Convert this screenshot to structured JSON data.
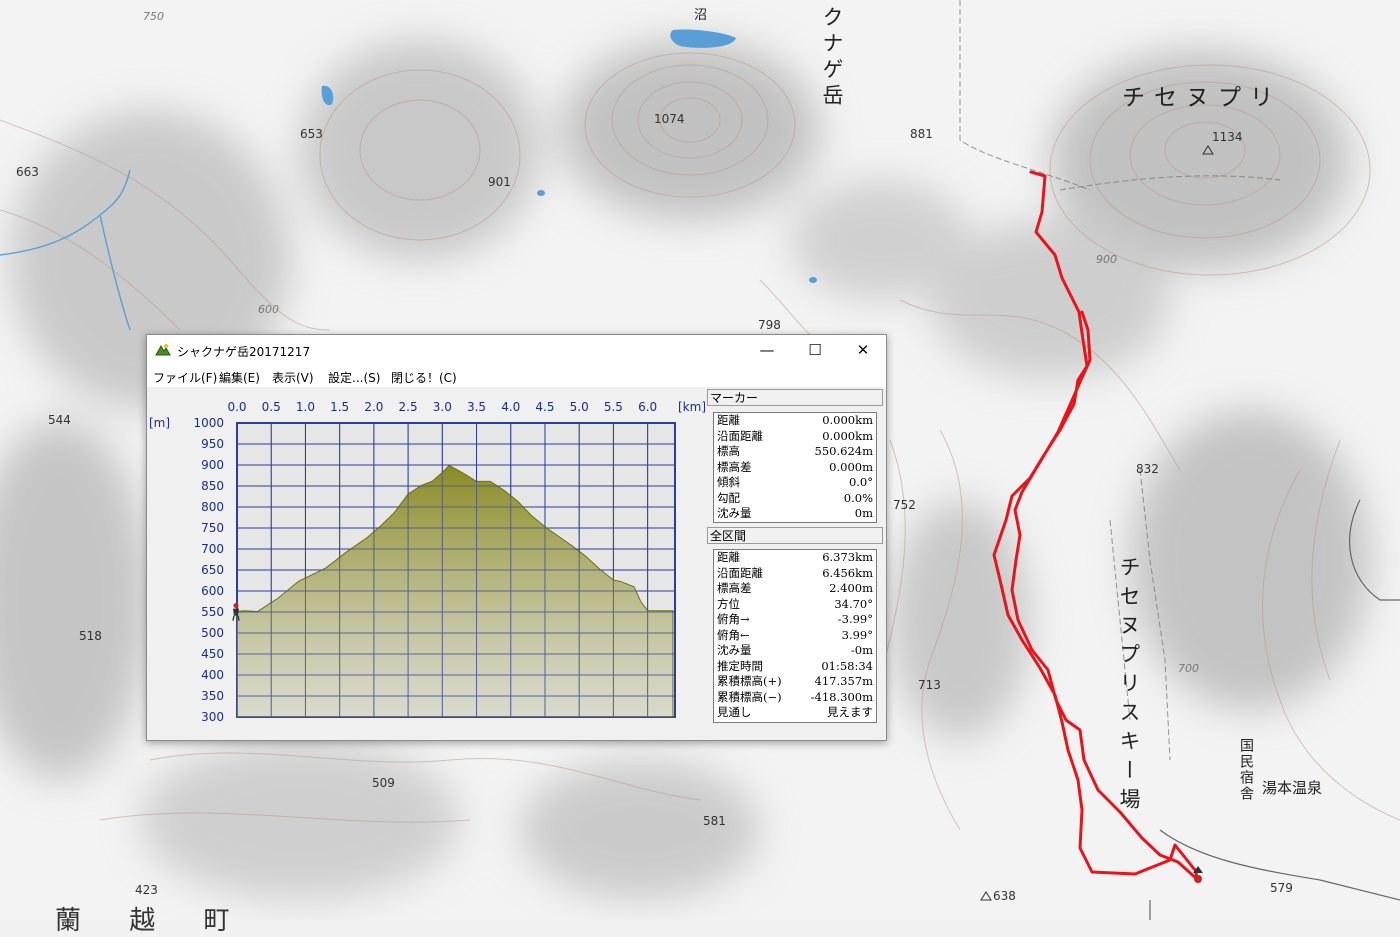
{
  "map": {
    "labels": {
      "chisenupuri": "チセヌプリ",
      "shakunage_fragment": "クナゲ岳",
      "ski_area": "チセヌプリスキー場",
      "kokumin": "国民宿舎",
      "onsen": "湯本温泉",
      "numa": "沼",
      "town_chars": "蘭 越 町"
    },
    "spot_heights": [
      "1074",
      "881",
      "653",
      "663",
      "901",
      "798",
      "544",
      "752",
      "713",
      "518",
      "509",
      "581",
      "423",
      "832",
      "638",
      "579",
      "1134"
    ],
    "contour_labels": [
      "750",
      "600",
      "900",
      "700"
    ],
    "track_color": "#e8141a"
  },
  "window": {
    "title": "シャクナゲ岳20171217",
    "controls": {
      "minimize": "—",
      "maximize": "☐",
      "close": "✕"
    },
    "menu": [
      "ファイル(F)",
      "編集(E)",
      "表示(V)",
      "設定...(S)",
      "閉じる！(C)"
    ],
    "chart_data": {
      "type": "area",
      "xlabel": "[km]",
      "ylabel": "[m]",
      "x_ticks": [
        "0.0",
        "0.5",
        "1.0",
        "1.5",
        "2.0",
        "2.5",
        "3.0",
        "3.5",
        "4.0",
        "4.5",
        "5.0",
        "5.5",
        "6.0"
      ],
      "y_ticks": [
        "1000",
        "950",
        "900",
        "850",
        "800",
        "750",
        "700",
        "650",
        "600",
        "550",
        "500",
        "450",
        "400",
        "350",
        "300"
      ],
      "xlim": [
        0,
        6.4
      ],
      "ylim": [
        300,
        1000
      ],
      "x": [
        0,
        0.1,
        0.3,
        0.6,
        0.9,
        1.3,
        1.6,
        1.9,
        2.1,
        2.3,
        2.5,
        2.7,
        2.85,
        3.0,
        3.1,
        3.3,
        3.5,
        3.7,
        3.9,
        4.1,
        4.3,
        4.5,
        4.7,
        4.9,
        5.1,
        5.3,
        5.5,
        5.6,
        5.8,
        5.9,
        6.0,
        6.1,
        6.37
      ],
      "y": [
        551,
        553,
        551,
        583,
        623,
        655,
        693,
        727,
        755,
        787,
        831,
        852,
        861,
        882,
        899,
        881,
        861,
        861,
        840,
        814,
        780,
        753,
        730,
        707,
        682,
        652,
        626,
        623,
        610,
        575,
        553,
        553,
        553
      ],
      "fill_color": "#8a8a22",
      "grid_color": "#2b3f9c"
    },
    "marker": {
      "header": "マーカー",
      "rows": [
        {
          "label": "距離",
          "value": "0.000km"
        },
        {
          "label": "沿面距離",
          "value": "0.000km"
        },
        {
          "label": "標高",
          "value": "550.624m"
        },
        {
          "label": "標高差",
          "value": "0.000m"
        },
        {
          "label": "傾斜",
          "value": "0.0°"
        },
        {
          "label": "勾配",
          "value": "0.0%"
        },
        {
          "label": "沈み量",
          "value": "0m"
        }
      ]
    },
    "total": {
      "header": "全区間",
      "rows": [
        {
          "label": "距離",
          "value": "6.373km"
        },
        {
          "label": "沿面距離",
          "value": "6.456km"
        },
        {
          "label": "標高差",
          "value": "2.400m"
        },
        {
          "label": "方位",
          "value": "34.70°"
        },
        {
          "label": "俯角→",
          "value": "-3.99°"
        },
        {
          "label": "俯角←",
          "value": "3.99°"
        },
        {
          "label": "沈み量",
          "value": "-0m"
        },
        {
          "label": "推定時間",
          "value": "01:58:34"
        },
        {
          "label": "累積標高(+)",
          "value": "417.357m"
        },
        {
          "label": "累積標高(−)",
          "value": "-418.300m"
        },
        {
          "label": "見通し",
          "value": "見えます"
        }
      ]
    }
  }
}
